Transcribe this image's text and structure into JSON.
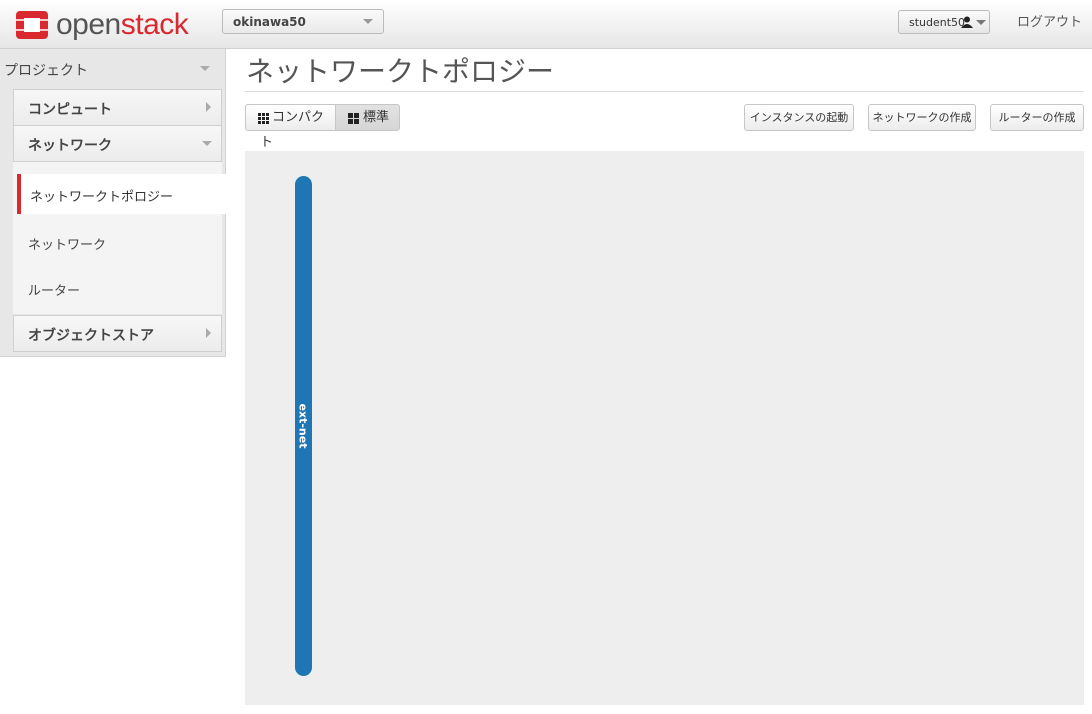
{
  "header": {
    "logo": {
      "open": "open",
      "stack": "stack"
    },
    "project": "okinawa50",
    "user": "student50",
    "logout": "ログアウト"
  },
  "sidebar": {
    "project": "プロジェクト",
    "groups": {
      "compute": "コンピュート",
      "network": "ネットワーク",
      "object_store": "オブジェクトストア"
    },
    "items": {
      "topology": "ネットワークトポロジー",
      "networks": "ネットワーク",
      "routers": "ルーター"
    }
  },
  "main": {
    "title": "ネットワークトポロジー",
    "view_buttons": {
      "compact": "コンパクト",
      "standard": "標準"
    },
    "actions": {
      "launch_instance": "インスタンスの起動",
      "create_network": "ネットワークの作成",
      "create_router": "ルーターの作成"
    },
    "topology": {
      "networks": [
        {
          "name": "ext-net",
          "color": "#1f76b4"
        }
      ]
    }
  },
  "colors": {
    "brand_red": "#d9282e",
    "network_blue": "#1f76b4",
    "canvas_bg": "#eeeeee"
  }
}
